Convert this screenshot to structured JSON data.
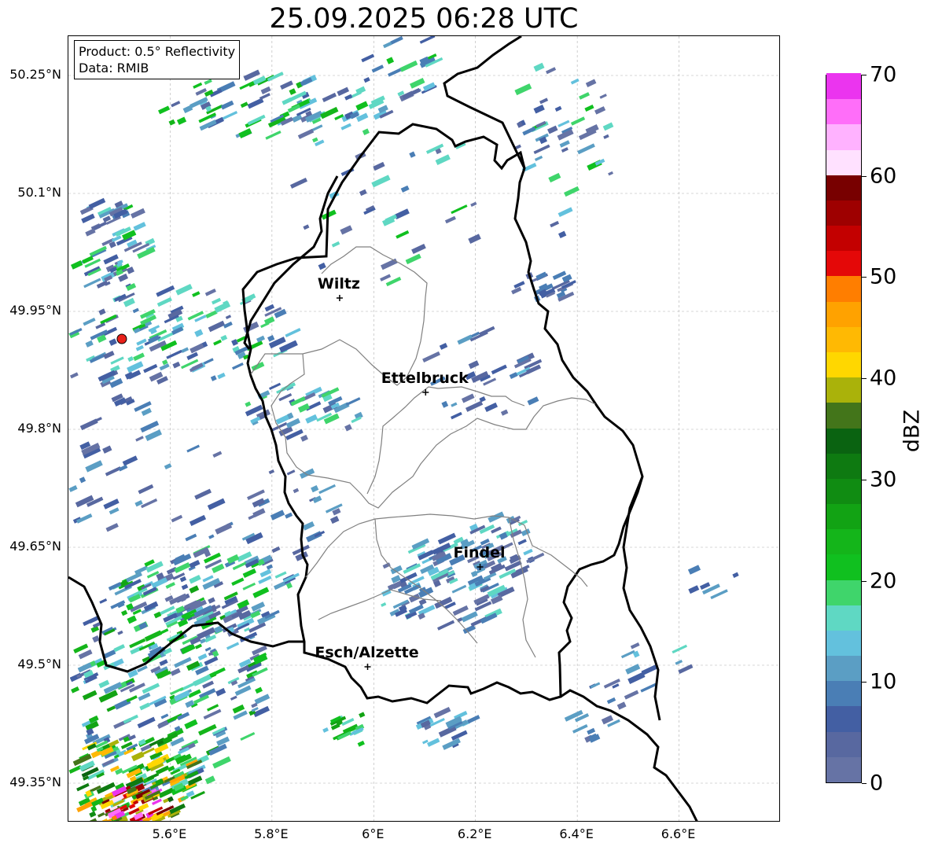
{
  "title": "25.09.2025 06:28 UTC",
  "info_box": {
    "product": "Product: 0.5° Reflectivity",
    "data": "Data: RMIB"
  },
  "map": {
    "lon_range": [
      5.4,
      6.8
    ],
    "lat_range": [
      49.3,
      50.3
    ],
    "lat_ticks": [
      "50.25°N",
      "50.1°N",
      "49.95°N",
      "49.8°N",
      "49.65°N",
      "49.5°N",
      "49.35°N"
    ],
    "lat_values": [
      50.25,
      50.1,
      49.95,
      49.8,
      49.65,
      49.5,
      49.35
    ],
    "lon_ticks": [
      "5.6°E",
      "5.8°E",
      "6°E",
      "6.2°E",
      "6.4°E",
      "6.6°E"
    ],
    "lon_values": [
      5.6,
      5.8,
      6.0,
      6.2,
      6.4,
      6.6
    ],
    "grid": true,
    "radar_site": {
      "lon": 5.505,
      "lat": 49.915,
      "color": "#e8201a"
    },
    "cities": [
      {
        "name": "Wiltz",
        "lon": 5.933,
        "lat": 49.967
      },
      {
        "name": "Ettelbruck",
        "lon": 6.102,
        "lat": 49.847
      },
      {
        "name": "Findel",
        "lon": 6.209,
        "lat": 49.625
      },
      {
        "name": "Esch/Alzette",
        "lon": 5.988,
        "lat": 49.498
      }
    ]
  },
  "colorbar": {
    "label": "dBZ",
    "min": 0,
    "max": 70,
    "ticks": [
      "0",
      "10",
      "20",
      "30",
      "40",
      "50",
      "60",
      "70"
    ],
    "tick_values": [
      0,
      10,
      20,
      30,
      40,
      50,
      60,
      70
    ],
    "colors": [
      "#6673a5",
      "#5868a0",
      "#435fa3",
      "#4a7eb5",
      "#5b9ec4",
      "#63c1dd",
      "#5fd8c3",
      "#3fd56b",
      "#10c01f",
      "#14b51a",
      "#12a314",
      "#108c12",
      "#0e7a11",
      "#0a6311",
      "#43751a",
      "#aab20a",
      "#ffd700",
      "#ffb903",
      "#ffa200",
      "#ff7e00",
      "#e40808",
      "#c30000",
      "#9e0000",
      "#780000",
      "#ffe1ff",
      "#ffb2ff",
      "#ff6ef9",
      "#eb34ef"
    ]
  }
}
